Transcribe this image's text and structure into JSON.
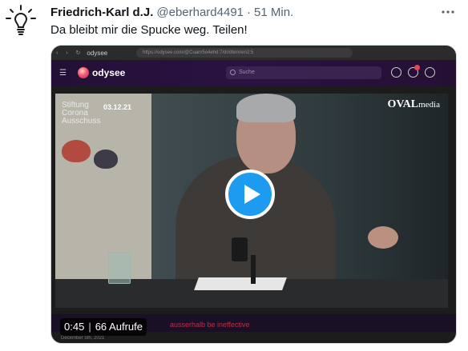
{
  "tweet": {
    "author_name": "Friedrich-Karl d.J.",
    "handle": "@eberhard4491",
    "separator": "·",
    "time": "51 Min.",
    "text": "Da bleibt mir die Spucke weg. Teilen!",
    "more_icon": "more-horizontal-icon",
    "avatar_icon": "light-bulb-icon"
  },
  "media": {
    "browser": {
      "url": "https://odysee.com/@Cuanr5o4ehd:7/dr/dtennen2:5",
      "tld": "odysee"
    },
    "site": {
      "logo_text": "odysee",
      "search_placeholder": "Suche"
    },
    "video": {
      "overlay_text_line1": "Stiftung",
      "overlay_text_line2": "Corona",
      "overlay_text_line3": "Ausschuss",
      "overlay_date": "03.12.21",
      "watermark_main": "OVAL",
      "watermark_sub": "media"
    },
    "caption_red": "ausserhalb be ineffective",
    "date_small": "December 5th, 2021",
    "duration": "0:45",
    "views": "66 Aufrufe",
    "play_icon": "play-icon"
  },
  "colors": {
    "twitter_blue": "#1d9bf0",
    "odysee_bar": "#2a1242",
    "text_secondary": "#536471"
  }
}
